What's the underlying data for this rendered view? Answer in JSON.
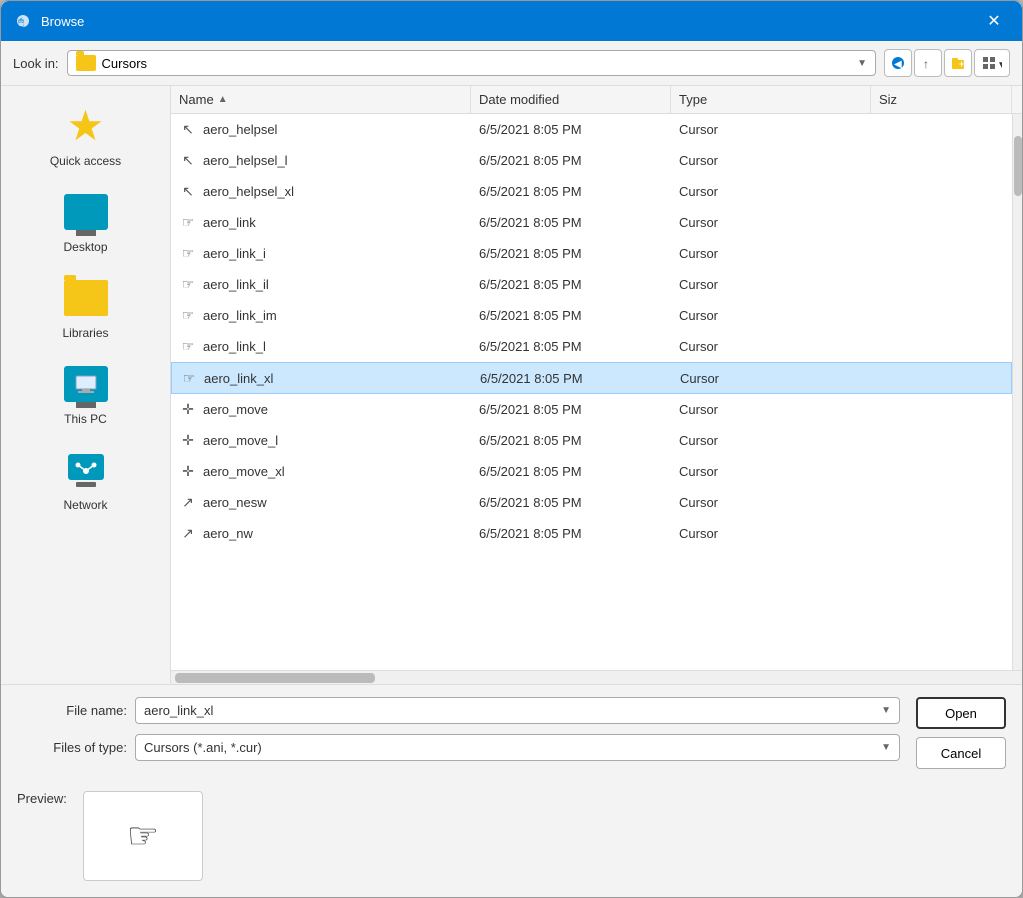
{
  "dialog": {
    "title": "Browse",
    "close_label": "✕"
  },
  "toolbar": {
    "look_in_label": "Look in:",
    "look_in_value": "Cursors",
    "back_tooltip": "Back",
    "up_tooltip": "Up",
    "new_folder_tooltip": "New folder",
    "views_tooltip": "Views"
  },
  "sidebar": {
    "items": [
      {
        "id": "quick-access",
        "label": "Quick access",
        "icon": "star"
      },
      {
        "id": "desktop",
        "label": "Desktop",
        "icon": "desktop"
      },
      {
        "id": "libraries",
        "label": "Libraries",
        "icon": "folder"
      },
      {
        "id": "this-pc",
        "label": "This PC",
        "icon": "computer"
      },
      {
        "id": "network",
        "label": "Network",
        "icon": "network"
      }
    ]
  },
  "file_list": {
    "columns": [
      {
        "id": "name",
        "label": "Name",
        "sort": "asc"
      },
      {
        "id": "date",
        "label": "Date modified"
      },
      {
        "id": "type",
        "label": "Type"
      },
      {
        "id": "size",
        "label": "Siz"
      }
    ],
    "rows": [
      {
        "name": "aero_helpsel",
        "date": "6/5/2021 8:05 PM",
        "type": "Cursor",
        "size": "",
        "icon": "cursor",
        "selected": false
      },
      {
        "name": "aero_helpsel_l",
        "date": "6/5/2021 8:05 PM",
        "type": "Cursor",
        "size": "",
        "icon": "cursor",
        "selected": false
      },
      {
        "name": "aero_helpsel_xl",
        "date": "6/5/2021 8:05 PM",
        "type": "Cursor",
        "size": "",
        "icon": "cursor",
        "selected": false
      },
      {
        "name": "aero_link",
        "date": "6/5/2021 8:05 PM",
        "type": "Cursor",
        "size": "",
        "icon": "hand",
        "selected": false
      },
      {
        "name": "aero_link_i",
        "date": "6/5/2021 8:05 PM",
        "type": "Cursor",
        "size": "",
        "icon": "hand",
        "selected": false
      },
      {
        "name": "aero_link_il",
        "date": "6/5/2021 8:05 PM",
        "type": "Cursor",
        "size": "",
        "icon": "hand",
        "selected": false
      },
      {
        "name": "aero_link_im",
        "date": "6/5/2021 8:05 PM",
        "type": "Cursor",
        "size": "",
        "icon": "hand",
        "selected": false
      },
      {
        "name": "aero_link_l",
        "date": "6/5/2021 8:05 PM",
        "type": "Cursor",
        "size": "",
        "icon": "hand",
        "selected": false
      },
      {
        "name": "aero_link_xl",
        "date": "6/5/2021 8:05 PM",
        "type": "Cursor",
        "size": "",
        "icon": "hand",
        "selected": true
      },
      {
        "name": "aero_move",
        "date": "6/5/2021 8:05 PM",
        "type": "Cursor",
        "size": "",
        "icon": "move",
        "selected": false
      },
      {
        "name": "aero_move_l",
        "date": "6/5/2021 8:05 PM",
        "type": "Cursor",
        "size": "",
        "icon": "move",
        "selected": false
      },
      {
        "name": "aero_move_xl",
        "date": "6/5/2021 8:05 PM",
        "type": "Cursor",
        "size": "",
        "icon": "move",
        "selected": false
      },
      {
        "name": "aero_nesw",
        "date": "6/5/2021 8:05 PM",
        "type": "Cursor",
        "size": "",
        "icon": "resize",
        "selected": false
      },
      {
        "name": "aero_nw",
        "date": "6/5/2021 8:05 PM",
        "type": "Cursor",
        "size": "",
        "icon": "resize",
        "selected": false
      }
    ]
  },
  "bottom": {
    "file_name_label": "File name:",
    "file_name_value": "aero_link_xl",
    "file_type_label": "Files of type:",
    "file_type_value": "Cursors (*.ani, *.cur)",
    "open_label": "Open",
    "cancel_label": "Cancel"
  },
  "preview": {
    "label": "Preview:"
  },
  "icons": {
    "cursor": "↖",
    "hand": "☞",
    "move": "✛",
    "resize": "↗"
  }
}
